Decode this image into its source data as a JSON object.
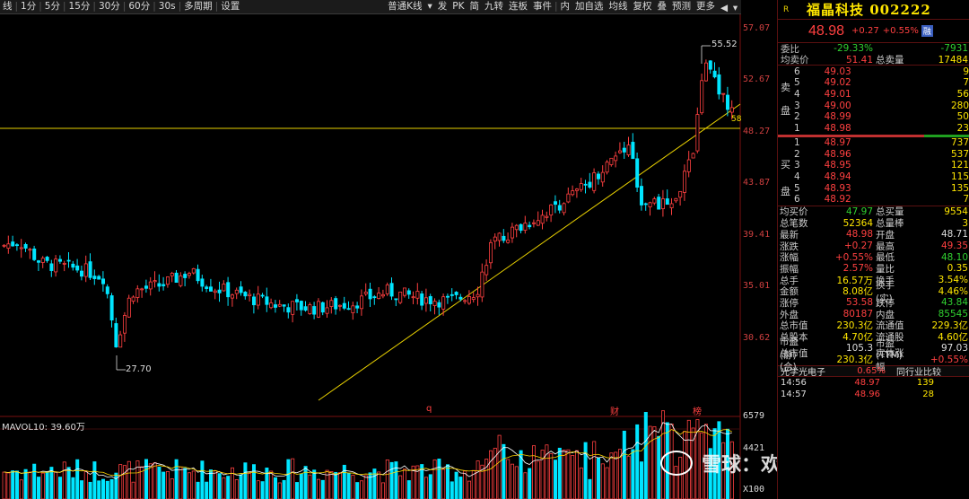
{
  "toolbar": {
    "left_items": [
      "线",
      "1分",
      "5分",
      "15分",
      "30分",
      "60分",
      "30s",
      "多周期",
      "设置"
    ],
    "mid_items": [
      "普通K线",
      "发",
      "PK",
      "简",
      "九转",
      "连板",
      "事件",
      "内",
      "加自选",
      "均线",
      "复权",
      "叠",
      "预测",
      "更多"
    ]
  },
  "chart": {
    "price_axis": [
      "57.07",
      "52.67",
      "48.27",
      "43.87",
      "39.41",
      "35.01",
      "30.62"
    ],
    "high_label": "55.52",
    "low_label": "27.70",
    "current_label": "58",
    "markers": {
      "q": "q",
      "cai": "财",
      "bang": "榜"
    },
    "vol_header": "MAVOL10: 39.60万",
    "vol_axis": [
      "6579",
      "4421",
      "X100"
    ],
    "ma_lines_colors": {
      "ma5": "#ffffff",
      "ma10": "#ffd700"
    }
  },
  "panel": {
    "r": "R",
    "name": "福晶科技 002222",
    "price": "48.98",
    "change": "+0.27",
    "pct": "+0.55%",
    "badge": "融",
    "weibi": {
      "label": "委比",
      "value": "-29.33%",
      "label2": "",
      "value2": "-7931"
    },
    "junmai": {
      "label": "均卖价",
      "value": "51.41",
      "label2": "总卖量",
      "value2": "17484"
    },
    "sells": [
      {
        "i": "6",
        "p": "49.03",
        "v": "9"
      },
      {
        "i": "5",
        "p": "49.02",
        "v": "7"
      },
      {
        "i": "4",
        "p": "49.01",
        "v": "56"
      },
      {
        "i": "3",
        "p": "49.00",
        "v": "280"
      },
      {
        "i": "2",
        "p": "48.99",
        "v": "50"
      },
      {
        "i": "1",
        "p": "48.98",
        "v": "23"
      }
    ],
    "buys": [
      {
        "i": "1",
        "p": "48.97",
        "v": "737"
      },
      {
        "i": "2",
        "p": "48.96",
        "v": "537"
      },
      {
        "i": "3",
        "p": "48.95",
        "v": "121"
      },
      {
        "i": "4",
        "p": "48.94",
        "v": "115"
      },
      {
        "i": "5",
        "p": "48.93",
        "v": "135"
      },
      {
        "i": "6",
        "p": "48.92",
        "v": "7"
      }
    ],
    "sell_side_chars": [
      "卖",
      "盘"
    ],
    "buy_side_chars": [
      "买",
      "盘"
    ],
    "stats": [
      {
        "k": "均买价",
        "v": "47.97",
        "vc": "grn",
        "k2": "总买量",
        "v2": "9554",
        "v2c": "yel"
      },
      {
        "k": "总笔数",
        "v": "52364",
        "vc": "yel",
        "k2": "总量棒",
        "v2": "3",
        "v2c": "yel"
      },
      {
        "k": "最新",
        "v": "48.98",
        "vc": "red",
        "k2": "开盘",
        "v2": "48.71",
        "v2c": "wht"
      },
      {
        "k": "涨跌",
        "v": "+0.27",
        "vc": "red",
        "k2": "最高",
        "v2": "49.35",
        "v2c": "red"
      },
      {
        "k": "涨幅",
        "v": "+0.55%",
        "vc": "red",
        "k2": "最低",
        "v2": "48.10",
        "v2c": "grn"
      },
      {
        "k": "振幅",
        "v": "2.57%",
        "vc": "red",
        "k2": "量比",
        "v2": "0.35",
        "v2c": "yel"
      },
      {
        "k": "总手",
        "v": "16.57万",
        "vc": "yel",
        "k2": "换手",
        "v2": "3.54%",
        "v2c": "yel"
      },
      {
        "k": "金额",
        "v": "8.08亿",
        "vc": "yel",
        "k2": "换手(实)",
        "v2": "4.46%",
        "v2c": "yel"
      },
      {
        "k": "涨停",
        "v": "53.58",
        "vc": "red",
        "k2": "跌停",
        "v2": "43.84",
        "v2c": "grn"
      },
      {
        "k": "外盘",
        "v": "80187",
        "vc": "red",
        "k2": "内盘",
        "v2": "85545",
        "v2c": "grn"
      },
      {
        "k": "总市值",
        "v": "230.3亿",
        "vc": "yel",
        "k2": "流通值",
        "v2": "229.3亿",
        "v2c": "yel"
      },
      {
        "k": "总股本",
        "v": "4.70亿",
        "vc": "yel",
        "k2": "流通股",
        "v2": "4.60亿",
        "v2c": "yel"
      },
      {
        "k": "市盈(静)",
        "v": "105.3",
        "vc": "wht",
        "k2": "市盈(TTM)",
        "v2": "97.03",
        "v2c": "wht"
      },
      {
        "k": "总市值(合)",
        "v": "230.3亿",
        "vc": "yel",
        "k2": "实体涨幅",
        "v2": "+0.55%",
        "v2c": "red"
      }
    ],
    "industry": {
      "name": "光学光电子",
      "pct": "0.65%",
      "compare": "同行业比较"
    },
    "ticks": [
      {
        "t": "14:56",
        "p": "48.97",
        "v": "139"
      },
      {
        "t": "14:57",
        "p": "48.96",
        "v": "28"
      }
    ]
  },
  "watermark": "雪球：欢喜趋势牛",
  "colors": {
    "up": "#ff4040",
    "down": "#00e5ff",
    "yellow": "#ffe600",
    "bg": "#000000"
  }
}
